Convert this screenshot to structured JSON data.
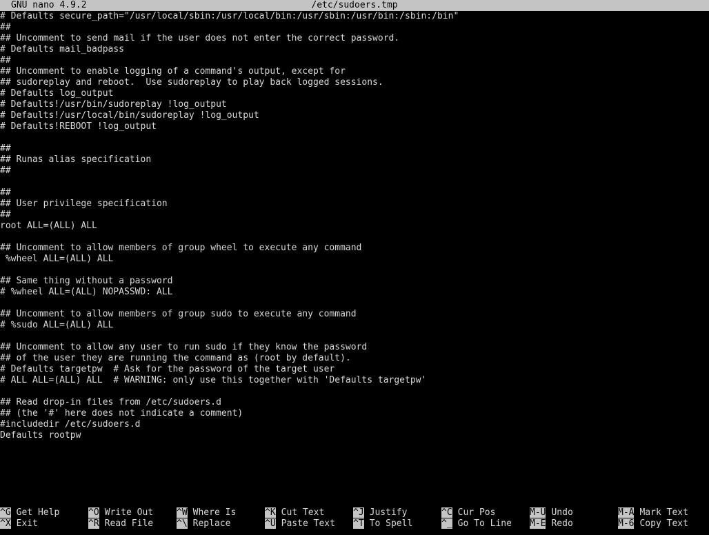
{
  "titlebar": {
    "app": "GNU nano 4.9.2",
    "filename": "/etc/sudoers.tmp"
  },
  "lines": [
    "# Defaults secure_path=\"/usr/local/sbin:/usr/local/bin:/usr/sbin:/usr/bin:/sbin:/bin\"",
    "##",
    "## Uncomment to send mail if the user does not enter the correct password.",
    "# Defaults mail_badpass",
    "##",
    "## Uncomment to enable logging of a command's output, except for",
    "## sudoreplay and reboot.  Use sudoreplay to play back logged sessions.",
    "# Defaults log_output",
    "# Defaults!/usr/bin/sudoreplay !log_output",
    "# Defaults!/usr/local/bin/sudoreplay !log_output",
    "# Defaults!REBOOT !log_output",
    "",
    "##",
    "## Runas alias specification",
    "##",
    "",
    "##",
    "## User privilege specification",
    "##",
    "root ALL=(ALL) ALL",
    "",
    "## Uncomment to allow members of group wheel to execute any command",
    " %wheel ALL=(ALL) ALL",
    "",
    "## Same thing without a password",
    "# %wheel ALL=(ALL) NOPASSWD: ALL",
    "",
    "## Uncomment to allow members of group sudo to execute any command",
    "# %sudo ALL=(ALL) ALL",
    "",
    "## Uncomment to allow any user to run sudo if they know the password",
    "## of the user they are running the command as (root by default).",
    "# Defaults targetpw  # Ask for the password of the target user",
    "# ALL ALL=(ALL) ALL  # WARNING: only use this together with 'Defaults targetpw'",
    "",
    "## Read drop-in files from /etc/sudoers.d",
    "## (the '#' here does not indicate a comment)",
    "#includedir /etc/sudoers.d",
    "Defaults rootpw"
  ],
  "shortcuts": {
    "row1": [
      {
        "key": "^G",
        "label": "Get Help"
      },
      {
        "key": "^O",
        "label": "Write Out"
      },
      {
        "key": "^W",
        "label": "Where Is"
      },
      {
        "key": "^K",
        "label": "Cut Text"
      },
      {
        "key": "^J",
        "label": "Justify"
      },
      {
        "key": "^C",
        "label": "Cur Pos"
      },
      {
        "key": "M-U",
        "label": "Undo"
      },
      {
        "key": "M-A",
        "label": "Mark Text"
      }
    ],
    "row2": [
      {
        "key": "^X",
        "label": "Exit"
      },
      {
        "key": "^R",
        "label": "Read File"
      },
      {
        "key": "^\\",
        "label": "Replace"
      },
      {
        "key": "^U",
        "label": "Paste Text"
      },
      {
        "key": "^T",
        "label": "To Spell"
      },
      {
        "key": "^_",
        "label": "Go To Line"
      },
      {
        "key": "M-E",
        "label": "Redo"
      },
      {
        "key": "M-6",
        "label": "Copy Text"
      }
    ]
  },
  "colors": {
    "background": "#000000",
    "foreground": "#d9d9d9",
    "inverse_bg": "#c4c4c4",
    "inverse_fg": "#000000"
  }
}
